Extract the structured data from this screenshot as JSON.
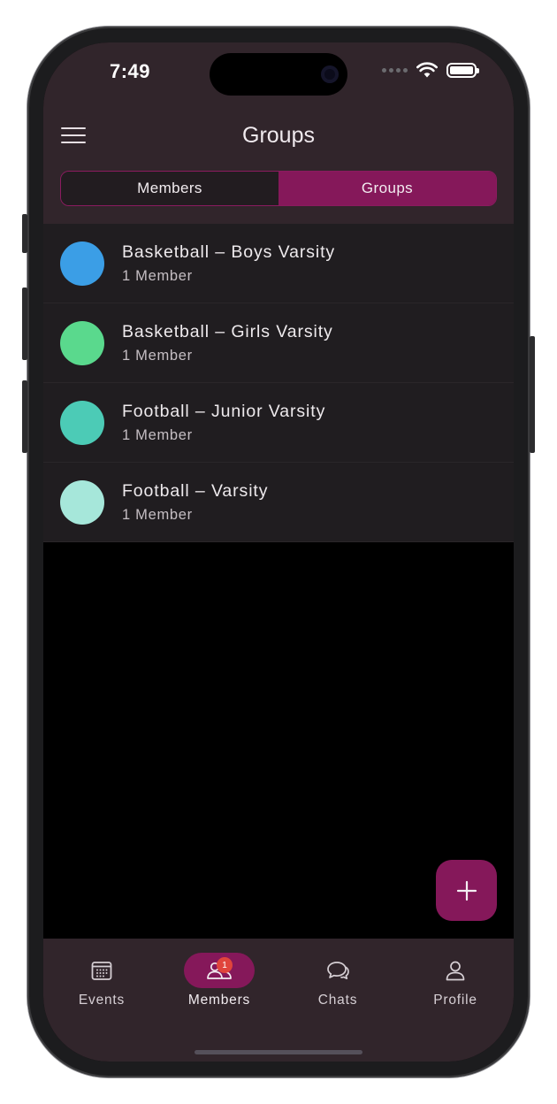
{
  "status_bar": {
    "time": "7:49"
  },
  "header": {
    "title": "Groups"
  },
  "segmented": {
    "members_label": "Members",
    "groups_label": "Groups",
    "selected": "Groups"
  },
  "groups": [
    {
      "name": "Basketball – Boys Varsity",
      "count": "1 Member",
      "color": "#3b9ee6"
    },
    {
      "name": "Basketball – Girls Varsity",
      "count": "1 Member",
      "color": "#5ad98d"
    },
    {
      "name": "Football – Junior Varsity",
      "count": "1 Member",
      "color": "#4ccbb6"
    },
    {
      "name": "Football – Varsity",
      "count": "1 Member",
      "color": "#a6e7da"
    }
  ],
  "fab": {
    "icon": "plus-icon"
  },
  "bottom_nav": {
    "items": [
      {
        "label": "Events",
        "icon": "calendar-icon"
      },
      {
        "label": "Members",
        "icon": "members-icon",
        "badge": "1"
      },
      {
        "label": "Chats",
        "icon": "chat-icon"
      },
      {
        "label": "Profile",
        "icon": "profile-icon"
      }
    ],
    "active": "Members"
  },
  "colors": {
    "accent": "#85185a",
    "header_bg": "#31252b",
    "row_bg": "#201d20",
    "badge": "#e0453c"
  }
}
